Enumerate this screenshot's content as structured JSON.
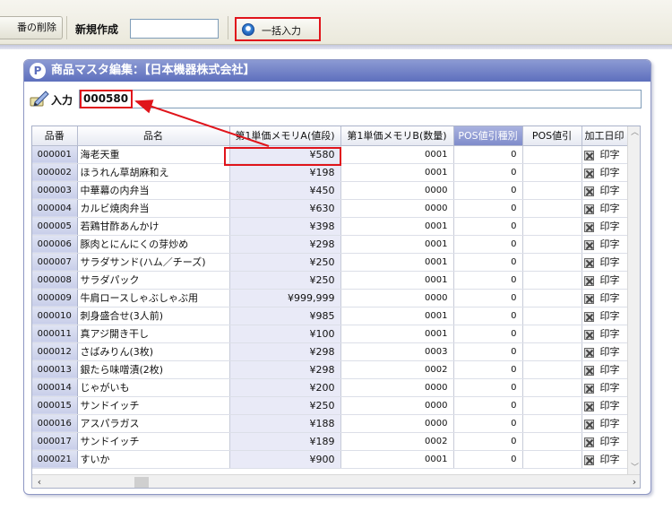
{
  "toolbar": {
    "delete_label": "番の削除",
    "new_label": "新規作成",
    "new_input_value": "",
    "bulk_label": "一括入力"
  },
  "panel": {
    "icon_letter": "P",
    "title": "商品マスタ編集：【日本機器株式会社】",
    "input_label": "入力",
    "input_value": "000580"
  },
  "grid": {
    "columns": [
      "品番",
      "品名",
      "第1単価メモリA(値段)",
      "第1単価メモリB(数量)",
      "POS値引種別",
      "POS値引",
      "加工日印"
    ],
    "rows": [
      {
        "code": "000001",
        "name": "海老天重",
        "a": "¥580",
        "b": "0001",
        "type": "0",
        "print": "印字"
      },
      {
        "code": "000002",
        "name": "ほうれん草胡麻和え",
        "a": "¥198",
        "b": "0001",
        "type": "0",
        "print": "印字"
      },
      {
        "code": "000003",
        "name": "中華幕の内弁当",
        "a": "¥450",
        "b": "0000",
        "type": "0",
        "print": "印字"
      },
      {
        "code": "000004",
        "name": "カルビ焼肉弁当",
        "a": "¥630",
        "b": "0000",
        "type": "0",
        "print": "印字"
      },
      {
        "code": "000005",
        "name": "若鶏甘酢あんかけ",
        "a": "¥398",
        "b": "0001",
        "type": "0",
        "print": "印字"
      },
      {
        "code": "000006",
        "name": "豚肉とにんにくの芽炒め",
        "a": "¥298",
        "b": "0001",
        "type": "0",
        "print": "印字"
      },
      {
        "code": "000007",
        "name": "サラダサンド(ハム／チーズ)",
        "a": "¥250",
        "b": "0001",
        "type": "0",
        "print": "印字"
      },
      {
        "code": "000008",
        "name": "サラダパック",
        "a": "¥250",
        "b": "0001",
        "type": "0",
        "print": "印字"
      },
      {
        "code": "000009",
        "name": "牛肩ロースしゃぶしゃぶ用",
        "a": "¥999,999",
        "b": "0000",
        "type": "0",
        "print": "印字"
      },
      {
        "code": "000010",
        "name": "刺身盛合せ(3人前)",
        "a": "¥985",
        "b": "0001",
        "type": "0",
        "print": "印字"
      },
      {
        "code": "000011",
        "name": "真アジ開き干し",
        "a": "¥100",
        "b": "0001",
        "type": "0",
        "print": "印字"
      },
      {
        "code": "000012",
        "name": "さばみりん(3枚)",
        "a": "¥298",
        "b": "0003",
        "type": "0",
        "print": "印字"
      },
      {
        "code": "000013",
        "name": "銀たら味噌漬(2枚)",
        "a": "¥298",
        "b": "0002",
        "type": "0",
        "print": "印字"
      },
      {
        "code": "000014",
        "name": "じゃがいも",
        "a": "¥200",
        "b": "0000",
        "type": "0",
        "print": "印字"
      },
      {
        "code": "000015",
        "name": "サンドイッチ",
        "a": "¥250",
        "b": "0000",
        "type": "0",
        "print": "印字"
      },
      {
        "code": "000016",
        "name": "アスパラガス",
        "a": "¥188",
        "b": "0000",
        "type": "0",
        "print": "印字"
      },
      {
        "code": "000017",
        "name": "サンドイッチ",
        "a": "¥189",
        "b": "0002",
        "type": "0",
        "print": "印字"
      },
      {
        "code": "000021",
        "name": "すいか",
        "a": "¥900",
        "b": "0001",
        "type": "0",
        "print": "印字"
      }
    ]
  },
  "colors": {
    "annotation_red": "#e0141b",
    "title_bar": "#6f7fc6",
    "highlight_header": "#8f9bd3"
  }
}
